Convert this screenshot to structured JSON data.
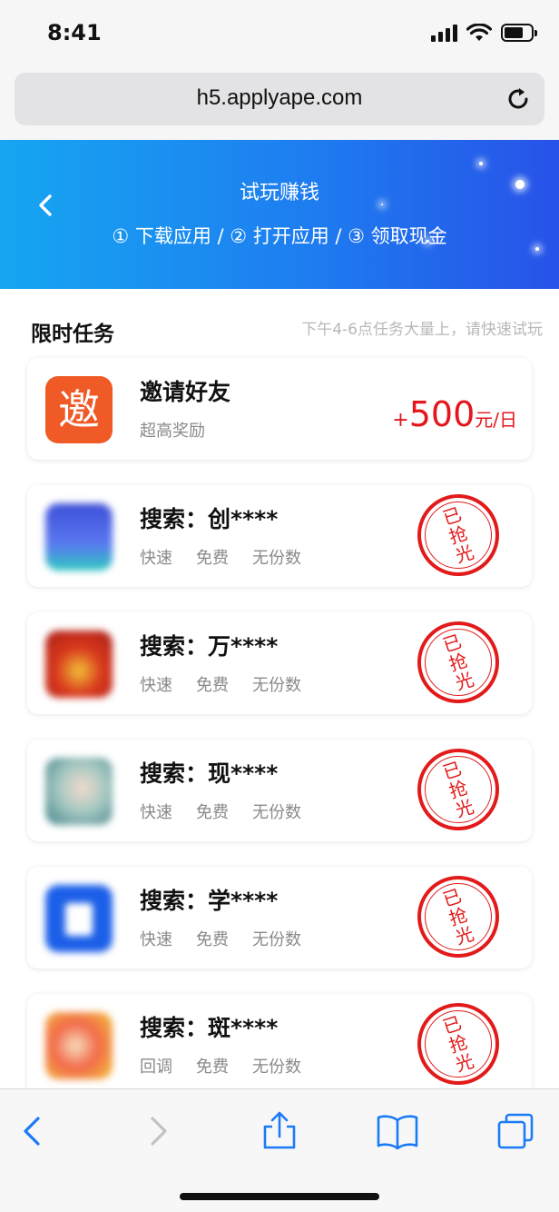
{
  "status_bar": {
    "time": "8:41"
  },
  "browser": {
    "url": "h5.applyape.com"
  },
  "banner": {
    "title": "试玩赚钱",
    "steps": "① 下载应用 / ② 打开应用 / ③ 领取现金"
  },
  "section": {
    "title": "限时任务",
    "hint": "下午4-6点任务大量上，请快速试玩"
  },
  "invite_card": {
    "icon_char": "邀",
    "title": "邀请好友",
    "subtitle": "超高奖励",
    "reward_plus": "+",
    "reward_amount": "500",
    "reward_unit": "元/日"
  },
  "tasks": [
    {
      "title": "搜索：创****",
      "tags": [
        "快速",
        "免费",
        "无份数"
      ],
      "stamp": "已抢光",
      "icon_color": "#3d5fe0"
    },
    {
      "title": "搜索：万****",
      "tags": [
        "快速",
        "免费",
        "无份数"
      ],
      "stamp": "已抢光",
      "icon_color": "#c7341f"
    },
    {
      "title": "搜索：现****",
      "tags": [
        "快速",
        "免费",
        "无份数"
      ],
      "stamp": "已抢光",
      "icon_color": "#5db7ad"
    },
    {
      "title": "搜索：学****",
      "tags": [
        "快速",
        "免费",
        "无份数"
      ],
      "stamp": "已抢光",
      "icon_color": "#1b5fe8"
    },
    {
      "title": "搜索：斑****",
      "tags": [
        "回调",
        "免费",
        "无份数"
      ],
      "stamp": "已抢光",
      "icon_color": "#f08a3a"
    }
  ],
  "colors": {
    "accent": "#1e7df0",
    "reward_red": "#e4161c",
    "invite_orange": "#ef5a26"
  },
  "toolbar_icons": [
    "back-icon",
    "forward-icon",
    "share-icon",
    "bookmarks-icon",
    "tabs-icon"
  ]
}
